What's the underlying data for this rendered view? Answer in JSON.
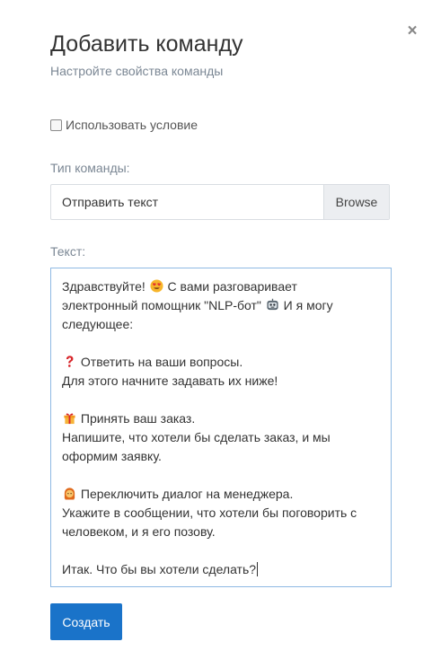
{
  "dialog": {
    "title": "Добавить команду",
    "subtitle": "Настройте свойства команды",
    "close_label": "×"
  },
  "condition": {
    "label": "Использовать условие",
    "checked": false
  },
  "command_type": {
    "label": "Тип команды:",
    "value": "Отправить текст",
    "browse_label": "Browse"
  },
  "text_field": {
    "label": "Текст:",
    "lines": [
      "Здравствуйте! ",
      " С вами разговаривает",
      "электронный помощник \"NLP-бот\" ",
      " И я могу",
      "следующее:",
      "",
      " Ответить на ваши вопросы.",
      "Для этого начните задавать их ниже!",
      "",
      " Принять ваш заказ.",
      "Напишите, что хотели бы сделать заказ, и мы",
      "оформим заявку.",
      "",
      " Переключить диалог на менеджера.",
      "Укажите в сообщении, что хотели бы поговорить с",
      "человеком, и я его позову.",
      "",
      "Итак. Что бы вы хотели сделать?"
    ],
    "emojis": {
      "heart_eyes": "heart-eyes-emoji",
      "robot": "robot-emoji",
      "question": "question-mark-emoji",
      "gift": "gift-emoji",
      "person": "person-emoji"
    }
  },
  "actions": {
    "submit_label": "Создать"
  },
  "colors": {
    "primary": "#1a73c9",
    "muted_text": "#7b8794",
    "focus_border": "#8fb9e3"
  }
}
